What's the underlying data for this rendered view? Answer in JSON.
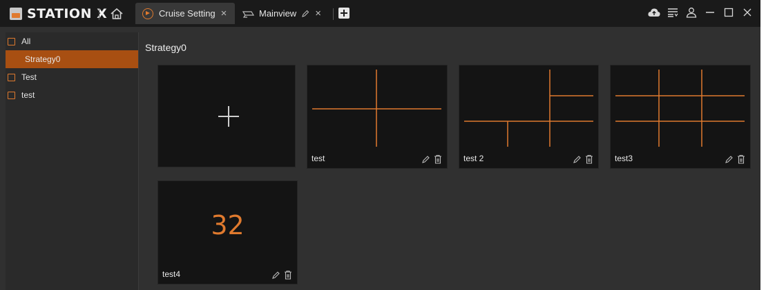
{
  "app": {
    "name": "STATION X"
  },
  "tabs": [
    {
      "label": "Cruise Setting",
      "close": "×"
    },
    {
      "label": "Mainview",
      "close": "×"
    }
  ],
  "sidebar": {
    "items": [
      {
        "label": "All",
        "checkbox": true
      },
      {
        "label": "Strategy0",
        "selected": true
      },
      {
        "label": "Test",
        "checkbox": true
      },
      {
        "label": "test",
        "checkbox": true
      }
    ]
  },
  "main": {
    "title": "Strategy0",
    "cards": [
      {
        "name": "",
        "kind": "add"
      },
      {
        "name": "test",
        "kind": "layout"
      },
      {
        "name": "test 2",
        "kind": "layout"
      },
      {
        "name": "test3",
        "kind": "layout"
      },
      {
        "name": "test4",
        "kind": "number",
        "number": "32"
      }
    ]
  },
  "colors": {
    "accent": "#e07a2e",
    "selected_bg": "#a84f12",
    "bg": "#303030",
    "titlebar": "#1a1a1a",
    "card": "#141414"
  }
}
